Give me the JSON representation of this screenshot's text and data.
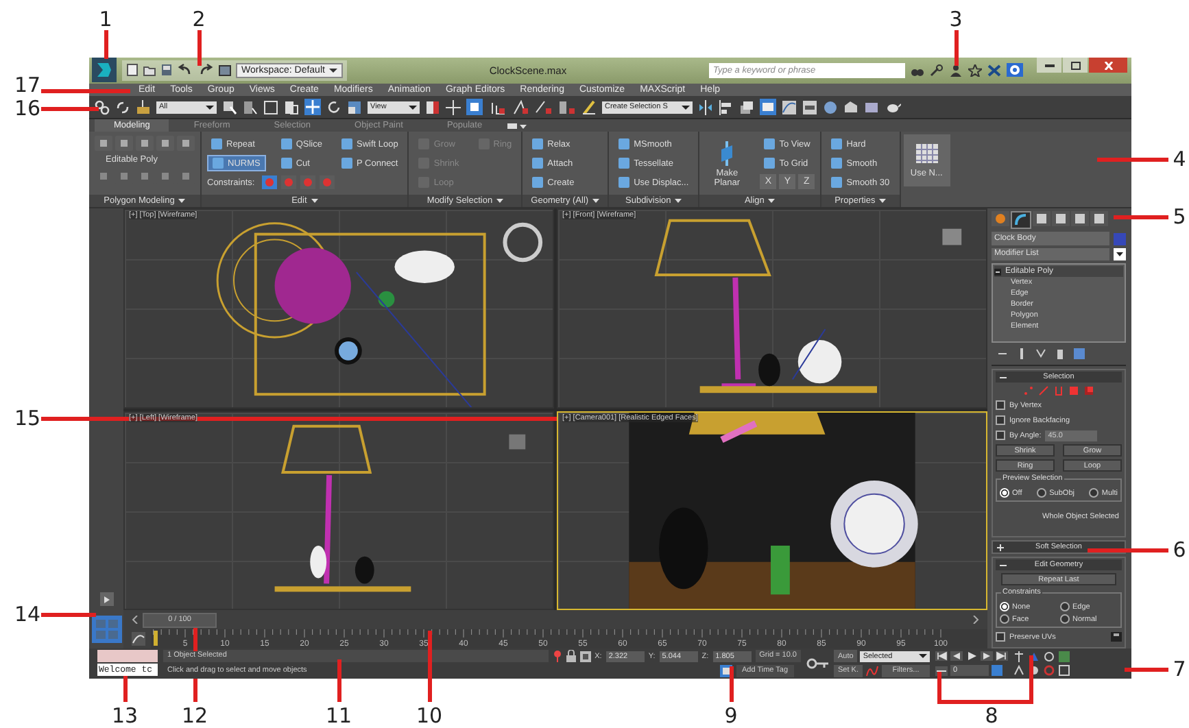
{
  "callouts": [
    {
      "label": "1"
    },
    {
      "label": "2"
    },
    {
      "label": "3"
    },
    {
      "label": "17"
    },
    {
      "label": "16"
    },
    {
      "label": "4"
    },
    {
      "label": "5"
    },
    {
      "label": "15"
    },
    {
      "label": "6"
    },
    {
      "label": "14"
    },
    {
      "label": "7"
    },
    {
      "label": "13"
    },
    {
      "label": "12"
    },
    {
      "label": "11"
    },
    {
      "label": "10"
    },
    {
      "label": "9"
    },
    {
      "label": "8"
    }
  ],
  "title_bar": {
    "workspace": "Workspace: Default",
    "title": "ClockScene.max",
    "search": {
      "placeholder": "Type a keyword or phrase"
    }
  },
  "menu": [
    "Edit",
    "Tools",
    "Group",
    "Views",
    "Create",
    "Modifiers",
    "Animation",
    "Graph Editors",
    "Rendering",
    "Customize",
    "MAXScript",
    "Help"
  ],
  "main_toolbar": {
    "selection_filter": "All",
    "reference_coordinate_system": "View",
    "named_selection_set": "Create Selection S"
  },
  "ribbon": {
    "tabs": [
      {
        "label": "Modeling",
        "selected": true
      },
      {
        "label": "Freeform",
        "selected": false
      },
      {
        "label": "Selection",
        "selected": false
      },
      {
        "label": "Object Paint",
        "selected": false
      },
      {
        "label": "Populate",
        "selected": false
      }
    ],
    "groups": [
      {
        "title": "Polygon Modeling",
        "items": [
          {
            "label": "Editable Poly",
            "kind": "label"
          }
        ]
      },
      {
        "title": "Edit",
        "items": [
          {
            "label": "Repeat",
            "kind": "button",
            "on": false
          },
          {
            "label": "NURMS",
            "kind": "button",
            "on": true
          },
          {
            "label": "QSlice",
            "kind": "button",
            "on": false
          },
          {
            "label": "Cut",
            "kind": "button",
            "on": false
          },
          {
            "label": "Swift Loop",
            "kind": "button",
            "on": false
          },
          {
            "label": "P Connect",
            "kind": "button",
            "on": false
          }
        ],
        "constraints_label": "Constraints:"
      },
      {
        "title": "Modify Selection",
        "items": [
          {
            "label": "Grow",
            "kind": "button",
            "disabled": true
          },
          {
            "label": "Shrink",
            "kind": "button",
            "disabled": true
          },
          {
            "label": "Loop",
            "kind": "button",
            "disabled": true
          },
          {
            "label": "Ring",
            "kind": "button",
            "disabled": true
          }
        ]
      },
      {
        "title": "Geometry (All)",
        "items": [
          {
            "label": "Relax",
            "kind": "button"
          },
          {
            "label": "Attach",
            "kind": "button"
          },
          {
            "label": "Create",
            "kind": "button"
          }
        ]
      },
      {
        "title": "Subdivision",
        "items": [
          {
            "label": "MSmooth",
            "kind": "button"
          },
          {
            "label": "Tessellate",
            "kind": "button"
          },
          {
            "label": "Use Displac...",
            "kind": "button"
          }
        ]
      },
      {
        "title": "Align",
        "items": [
          {
            "label": "Make Planar",
            "kind": "large"
          },
          {
            "label": "To View",
            "kind": "button"
          },
          {
            "label": "To Grid",
            "kind": "button"
          }
        ],
        "axes": [
          "X",
          "Y",
          "Z"
        ]
      },
      {
        "title": "Properties",
        "items": [
          {
            "label": "Hard",
            "kind": "button"
          },
          {
            "label": "Smooth",
            "kind": "button"
          },
          {
            "label": "Smooth 30",
            "kind": "button"
          }
        ]
      }
    ],
    "large_button": "Use N..."
  },
  "viewports": [
    {
      "label": "[+] [Top] [Wireframe]",
      "kind": "top",
      "active": false
    },
    {
      "label": "[+] [Front] [Wireframe]",
      "kind": "front",
      "active": false
    },
    {
      "label": "[+] [Left] [Wireframe]",
      "kind": "left",
      "active": false
    },
    {
      "label": "[+] [Camera001] [Realistic Edged Faces]",
      "kind": "camera",
      "active": true
    }
  ],
  "command_panel": {
    "tabs": [
      {
        "selected": false
      },
      {
        "selected": true
      },
      {
        "selected": false
      },
      {
        "selected": false
      },
      {
        "selected": false
      },
      {
        "selected": false
      }
    ],
    "object_name": "Clock Body",
    "modifier_list": "Modifier List",
    "stack": [
      {
        "label": "Editable Poly",
        "expanded": true,
        "children": [
          {
            "label": "Vertex"
          },
          {
            "label": "Edge"
          },
          {
            "label": "Border"
          },
          {
            "label": "Polygon"
          },
          {
            "label": "Element"
          }
        ]
      }
    ],
    "selection": {
      "title": "Selection",
      "expanded": true,
      "checkboxes": [
        {
          "label": "By Vertex",
          "checked": false
        },
        {
          "label": "Ignore Backfacing",
          "checked": false
        },
        {
          "label": "By Angle:",
          "checked": false
        }
      ],
      "angle": "45.0",
      "buttons": [
        "Shrink",
        "Grow",
        "Ring",
        "Loop"
      ],
      "preview_title": "Preview Selection",
      "preview_options": [
        {
          "label": "Off",
          "selected": true
        },
        {
          "label": "SubObj",
          "selected": false
        },
        {
          "label": "Multi",
          "selected": false
        }
      ],
      "status": "Whole Object Selected"
    },
    "soft_selection": {
      "title": "Soft Selection",
      "expanded": false
    },
    "edit_geometry": {
      "title": "Edit Geometry",
      "expanded": true,
      "repeat_button": "Repeat Last",
      "constraints_title": "Constraints",
      "constraints": [
        {
          "label": "None",
          "selected": true
        },
        {
          "label": "Edge",
          "selected": false
        },
        {
          "label": "Face",
          "selected": false
        },
        {
          "label": "Normal",
          "selected": false
        }
      ],
      "preserve_uvs": {
        "label": "Preserve UVs",
        "checked": false
      }
    }
  },
  "time_slider": {
    "label": "0 / 100",
    "level": 0
  },
  "track_bar": {
    "labels": [
      "5",
      "10",
      "15",
      "20",
      "25",
      "30",
      "35",
      "40",
      "45",
      "50",
      "55",
      "60",
      "65",
      "70",
      "75",
      "80",
      "85",
      "90",
      "95",
      "100"
    ]
  },
  "status_bar": {
    "listener": "Welcome tc",
    "prompt": "1 Object Selected",
    "hint": "Click and drag to select and move objects",
    "coordinates": [
      {
        "label": "X:",
        "value": "2.322"
      },
      {
        "label": "Y:",
        "value": "5.044"
      },
      {
        "label": "Z:",
        "value": "1.805"
      }
    ],
    "grid": "Grid = 10.0",
    "add_time_tag": "Add Time Tag"
  },
  "animation": {
    "auto_key": "Auto",
    "set_key": "Set K.",
    "key_filter": "Selected",
    "filters": "Filters...",
    "frame": "0"
  }
}
